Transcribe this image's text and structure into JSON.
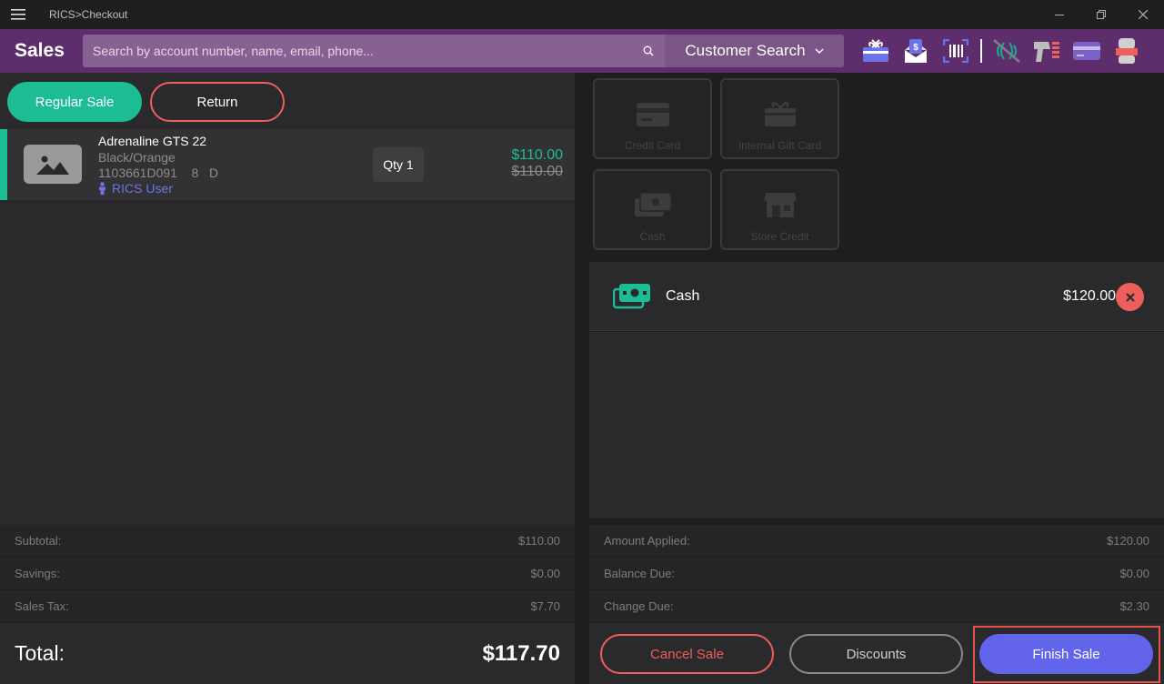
{
  "window": {
    "title": "RICS>Checkout",
    "menu_icon": "hamburger-icon",
    "controls": [
      "minimize-icon",
      "restore-icon",
      "close-icon"
    ]
  },
  "header": {
    "title": "Sales",
    "search_placeholder": "Search by account number, name, email, phone...",
    "customer_search_label": "Customer Search",
    "icons": [
      "gift-card-icon",
      "email-receipt-icon",
      "barcode-scanner-icon",
      "nfc-disabled-icon",
      "printer-icon",
      "card-reader-icon",
      "cash-drawer-icon"
    ],
    "accent": "#5e2e6c"
  },
  "sale_tabs": {
    "regular": "Regular Sale",
    "return": "Return"
  },
  "line_items": [
    {
      "name": "Adrenaline GTS 22",
      "color": "Black/Orange",
      "sku": "1103661D091",
      "size": "8",
      "width": "D",
      "user": "RICS User",
      "qty": "Qty 1",
      "price": "$110.00",
      "original_price": "$110.00"
    }
  ],
  "left_totals": {
    "subtotal_label": "Subtotal:",
    "subtotal": "$110.00",
    "savings_label": "Savings:",
    "savings": "$0.00",
    "tax_label": "Sales Tax:",
    "tax": "$7.70",
    "total_label": "Total:",
    "total": "$117.70"
  },
  "tenders": [
    {
      "label": "Credit Card",
      "icon": "credit-card-icon"
    },
    {
      "label": "Internal Gift Card",
      "icon": "gift-card-icon"
    },
    {
      "label": "Cash",
      "icon": "cash-icon"
    },
    {
      "label": "Store Credit",
      "icon": "store-icon"
    }
  ],
  "payments": [
    {
      "method": "Cash",
      "amount": "$120.00",
      "icon": "cash-icon"
    }
  ],
  "right_totals": {
    "applied_label": "Amount Applied:",
    "applied": "$120.00",
    "balance_label": "Balance Due:",
    "balance": "$0.00",
    "change_label": "Change Due:",
    "change": "$2.30"
  },
  "actions": {
    "cancel": "Cancel Sale",
    "discounts": "Discounts",
    "finish": "Finish Sale"
  },
  "colors": {
    "green": "#1cbc95",
    "red": "#ec5f5b",
    "blue": "#6264ec"
  }
}
